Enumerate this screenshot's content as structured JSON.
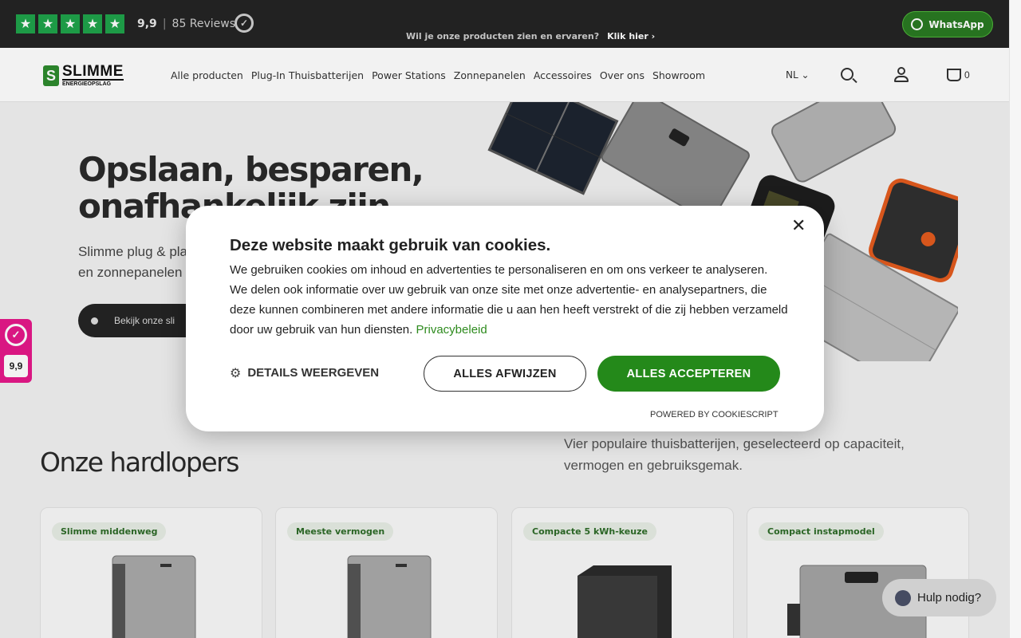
{
  "topbar": {
    "rating_score": "9,9",
    "reviews_label": "85 Reviews",
    "promo_text": "Wil je onze producten zien en ervaren?",
    "promo_link": "Klik hier",
    "whatsapp_label": "WhatsApp",
    "star_color": "#1fa34a",
    "star_count": 5
  },
  "header": {
    "logo_line1": "SLIMME",
    "logo_line2": "ENERGIEOPSLAG",
    "nav": [
      "Alle producten",
      "Plug-In Thuisbatterijen",
      "Power Stations",
      "Zonnepanelen",
      "Accessoires",
      "Over ons",
      "Showroom"
    ],
    "language": "NL",
    "cart_count": "0"
  },
  "hero": {
    "title": "Opslaan, besparen, onafhankelijk zijn",
    "subtitle": "Slimme plug & play thuisbatterijen en zonnepanelen",
    "button": "Bekijk onze slimme oplossingen"
  },
  "section": {
    "title": "Onze hardlopers",
    "description": "Vier populaire thuisbatterijen, geselecteerd op capaciteit, vermogen en gebruiksgemak.",
    "cards": [
      {
        "badge": "Slimme middenweg"
      },
      {
        "badge": "Meeste vermogen"
      },
      {
        "badge": "Compacte 5 kWh-keuze"
      },
      {
        "badge": "Compact instapmodel"
      }
    ]
  },
  "kiyoh_side": {
    "score": "9,9"
  },
  "help": {
    "label": "Hulp nodig?"
  },
  "cookie": {
    "title": "Deze website maakt gebruik van cookies.",
    "body": "We gebruiken cookies om inhoud en advertenties te personaliseren en om ons verkeer te analyseren. We delen ook informatie over uw gebruik van onze site met onze advertentie- en analysepartners, die deze kunnen combineren met andere informatie die u aan hen heeft verstrekt of die zij hebben verzameld door uw gebruik van hun diensten.",
    "privacy_link": "Privacybeleid",
    "details_label": "DETAILS WEERGEVEN",
    "reject_label": "ALLES AFWIJZEN",
    "accept_label": "ALLES ACCEPTEREN",
    "powered_by": "POWERED BY COOKIESCRIPT",
    "accent_color": "#24891a"
  }
}
